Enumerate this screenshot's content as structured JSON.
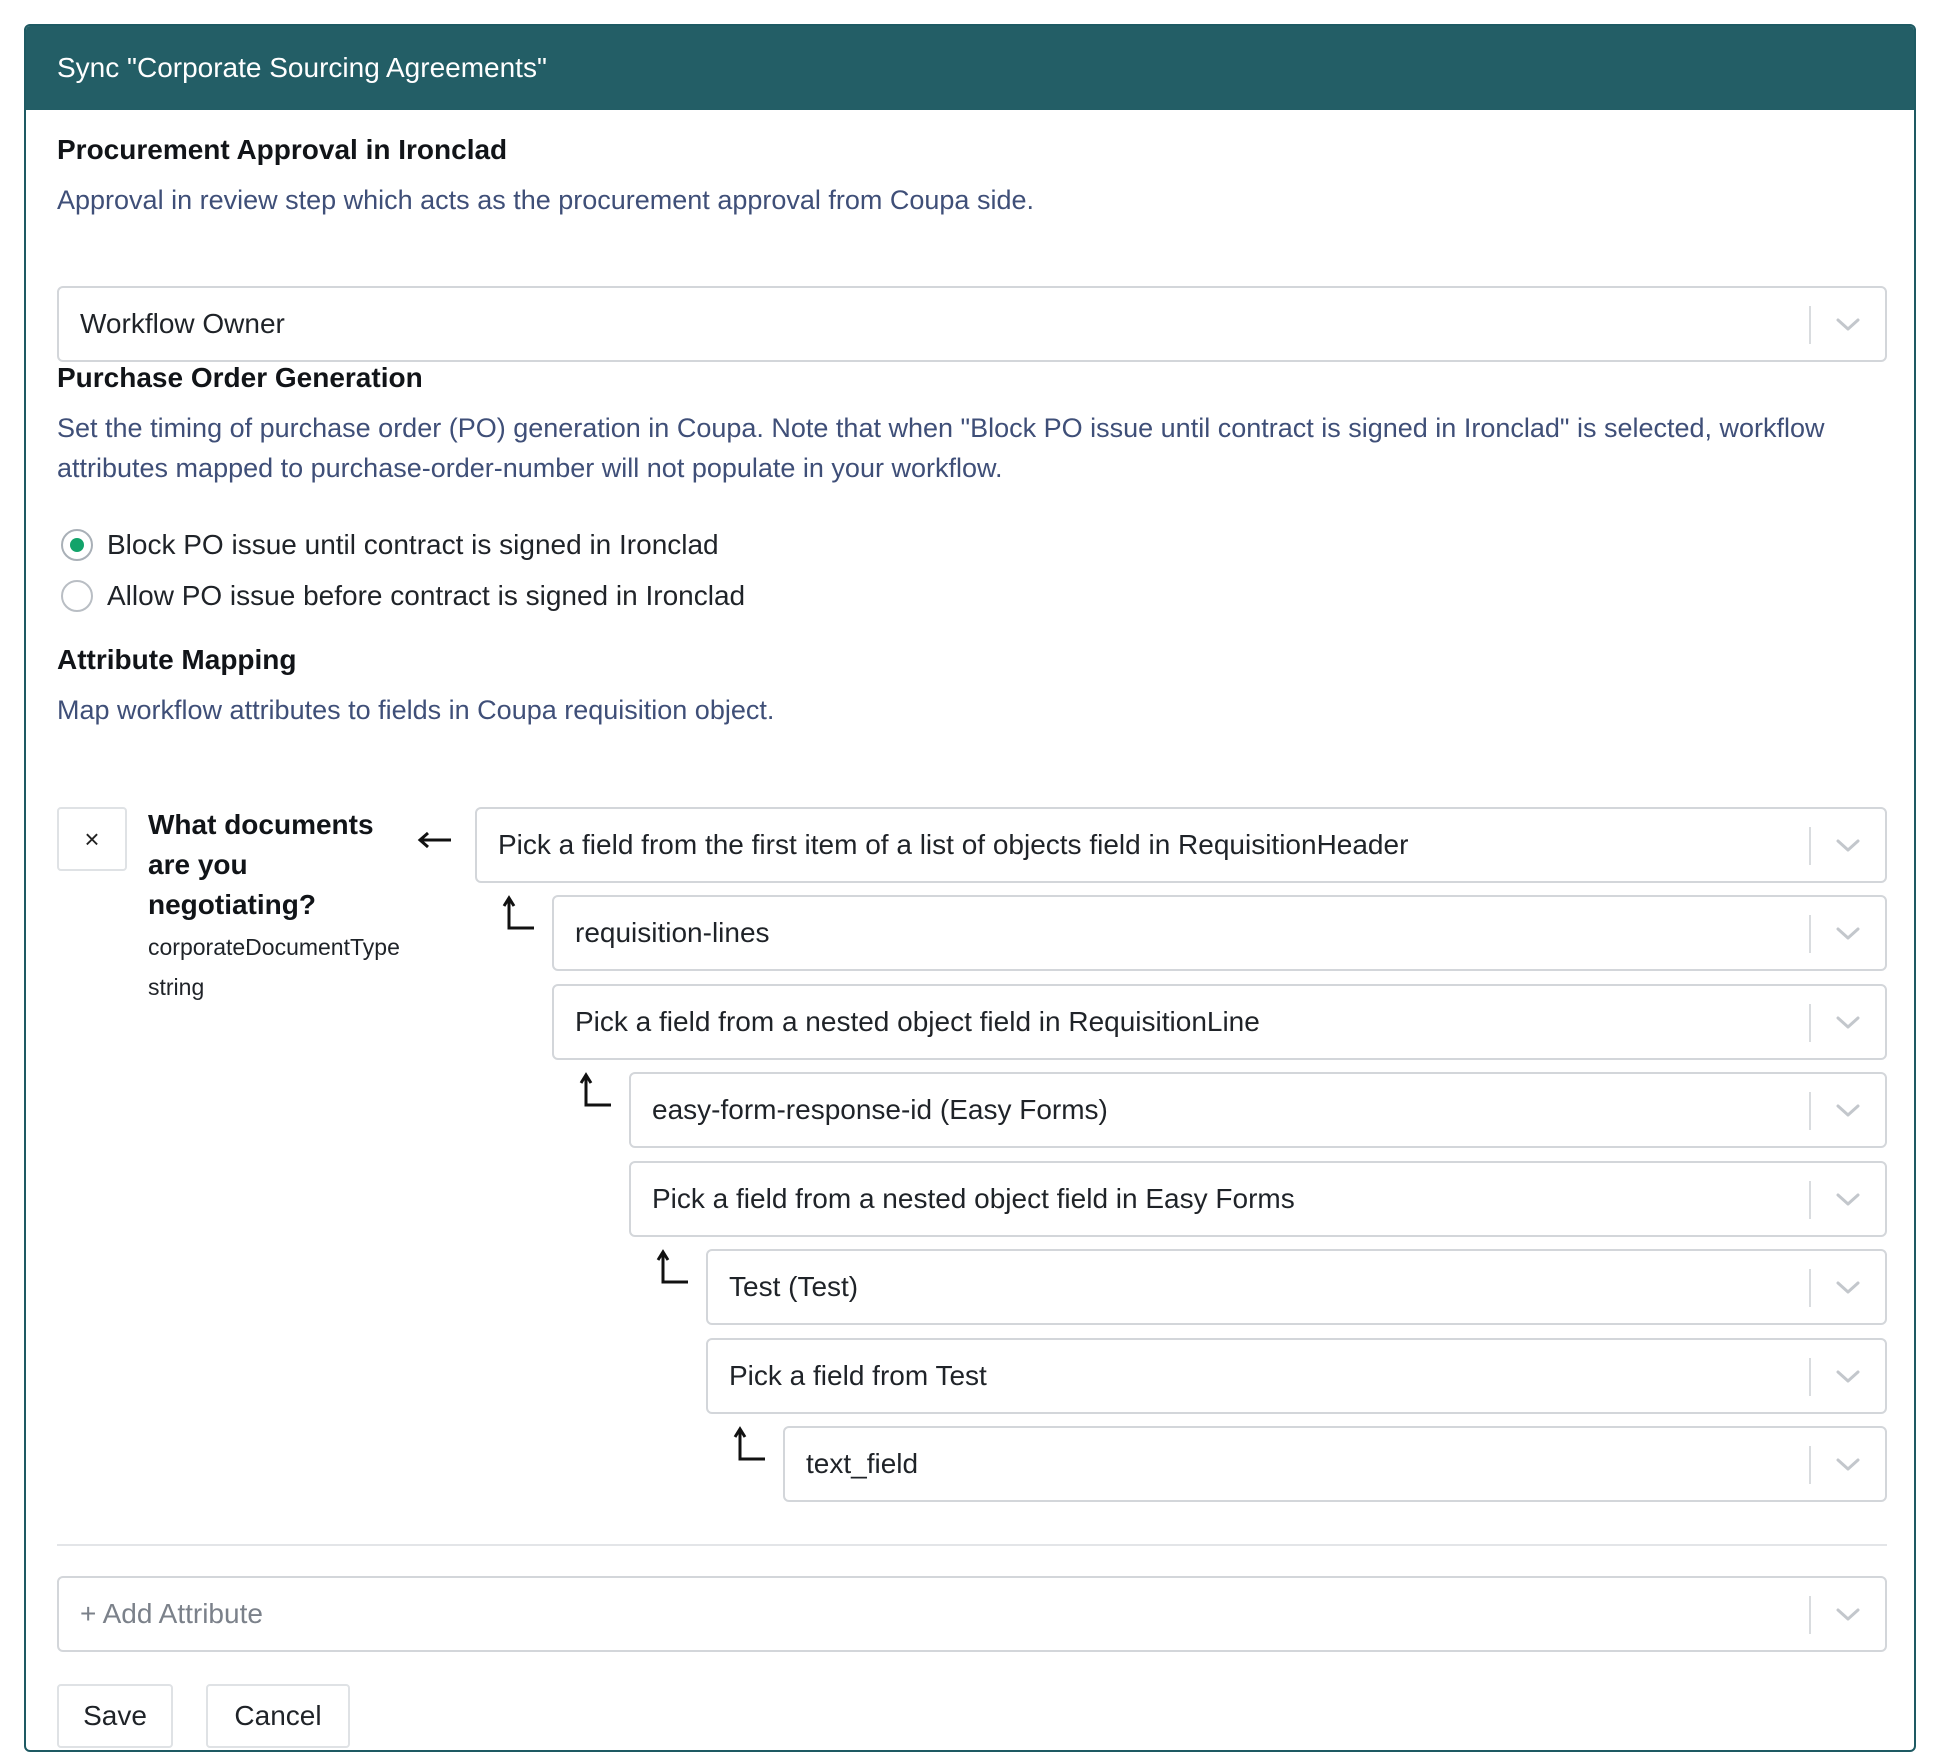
{
  "modal": {
    "title": "Sync \"Corporate Sourcing Agreements\""
  },
  "procurement": {
    "heading": "Procurement Approval in Ironclad",
    "description": "Approval in review step which acts as the procurement approval from Coupa side.",
    "selected": "Workflow Owner"
  },
  "purchase_order": {
    "heading": "Purchase Order Generation",
    "description": "Set the timing of purchase order (PO) generation in Coupa. Note that when \"Block PO issue until contract is signed in Ironclad\" is selected, workflow attributes mapped to purchase-order-number will not populate in your workflow.",
    "options": [
      {
        "label": "Block PO issue until contract is signed in Ironclad",
        "checked": true
      },
      {
        "label": "Allow PO issue before contract is signed in Ironclad",
        "checked": false
      }
    ]
  },
  "attribute_mapping": {
    "heading": "Attribute Mapping",
    "description": "Map workflow attributes to fields in Coupa requisition object.",
    "attribute": {
      "remove_symbol": "×",
      "title": "What documents are you negotiating?",
      "key": "corporateDocumentType",
      "type": "string"
    },
    "field_chain": [
      "Pick a field from the first item of a list of objects field in RequisitionHeader",
      "requisition-lines",
      "Pick a field from a nested object field in RequisitionLine",
      "easy-form-response-id (Easy Forms)",
      "Pick a field from a nested object field in Easy Forms",
      "Test (Test)",
      "Pick a field from Test",
      "text_field"
    ],
    "add_attribute_placeholder": "+ Add Attribute"
  },
  "footer": {
    "save_label": "Save",
    "cancel_label": "Cancel"
  },
  "colors": {
    "header_bg": "#235e66",
    "radio_checked": "#12a36a",
    "description_text": "#3f4f78"
  }
}
